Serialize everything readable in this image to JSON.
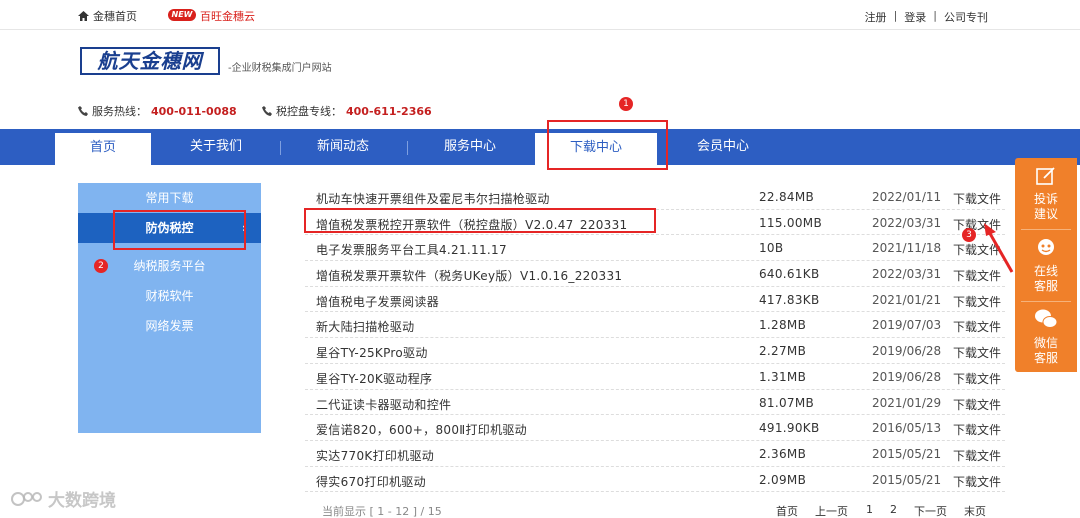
{
  "topbar": {
    "home": "金穗首页",
    "new_badge": "NEW",
    "cloud": "百旺金穗云",
    "register": "注册",
    "login": "登录",
    "company": "公司专刊",
    "sep": "|"
  },
  "logo": {
    "text": "航天金穗网",
    "slogan": "-企业财税集成门户网站"
  },
  "hotlines": [
    {
      "label": "服务热线：",
      "number": "400-011-0088"
    },
    {
      "label": "税控盘专线：",
      "number": "400-611-2366"
    }
  ],
  "nav": {
    "items": [
      {
        "label": "首页",
        "active": true
      },
      {
        "label": "关于我们",
        "active": false
      },
      {
        "label": "新闻动态",
        "active": false
      },
      {
        "label": "服务中心",
        "active": false
      },
      {
        "label": "下载中心",
        "active": true
      },
      {
        "label": "会员中心",
        "active": false
      }
    ]
  },
  "annotations": [
    "1",
    "2",
    "3"
  ],
  "sidebar": {
    "items": [
      {
        "label": "常用下载",
        "active": false
      },
      {
        "label": "防伪税控",
        "active": true
      },
      {
        "label": "纳税服务平台",
        "active": false
      },
      {
        "label": "财税软件",
        "active": false
      },
      {
        "label": "网络发票",
        "active": false
      }
    ],
    "arrow": "›"
  },
  "files": [
    {
      "name": "机动车快速开票组件及霍尼韦尔扫描枪驱动",
      "size": "22.84MB",
      "date": "2022/01/11",
      "action": "下载文件"
    },
    {
      "name": "增值税发票税控开票软件（税控盘版）V2.0.47_220331",
      "size": "115.00MB",
      "date": "2022/03/31",
      "action": "下载文件"
    },
    {
      "name": "电子发票服务平台工具4.21.11.17",
      "size": "10B",
      "date": "2021/11/18",
      "action": "下载文件"
    },
    {
      "name": "增值税发票开票软件（税务UKey版）V1.0.16_220331",
      "size": "640.61KB",
      "date": "2022/03/31",
      "action": "下载文件"
    },
    {
      "name": "增值税电子发票阅读器",
      "size": "417.83KB",
      "date": "2021/01/21",
      "action": "下载文件"
    },
    {
      "name": "新大陆扫描枪驱动",
      "size": "1.28MB",
      "date": "2019/07/03",
      "action": "下载文件"
    },
    {
      "name": "星谷TY-25KPro驱动",
      "size": "2.27MB",
      "date": "2019/06/28",
      "action": "下载文件"
    },
    {
      "name": "星谷TY-20K驱动程序",
      "size": "1.31MB",
      "date": "2019/06/28",
      "action": "下载文件"
    },
    {
      "name": "二代证读卡器驱动和控件",
      "size": "81.07MB",
      "date": "2021/01/29",
      "action": "下载文件"
    },
    {
      "name": "爱信诺820，600+，800Ⅱ打印机驱动",
      "size": "491.90KB",
      "date": "2016/05/13",
      "action": "下载文件"
    },
    {
      "name": "实达770K打印机驱动",
      "size": "2.36MB",
      "date": "2015/05/21",
      "action": "下载文件"
    },
    {
      "name": "得实670打印机驱动",
      "size": "2.09MB",
      "date": "2015/05/21",
      "action": "下载文件"
    }
  ],
  "pager": {
    "summary": "当前显示 [ 1 - 12 ] / 15",
    "first": "首页",
    "prev": "上一页",
    "p1": "1",
    "p2": "2",
    "next": "下一页",
    "last": "末页"
  },
  "service": [
    {
      "label": "投诉\n建议",
      "icon": "edit-icon"
    },
    {
      "label": "在线\n客服",
      "icon": "support-agent-icon"
    },
    {
      "label": "微信\n客服",
      "icon": "wechat-icon"
    }
  ],
  "watermark": "大数跨境",
  "colors": {
    "nav": "#2d5ec2",
    "accent_red": "#d9211c",
    "sidebar": "#80b4f0",
    "service": "#f0802a"
  }
}
